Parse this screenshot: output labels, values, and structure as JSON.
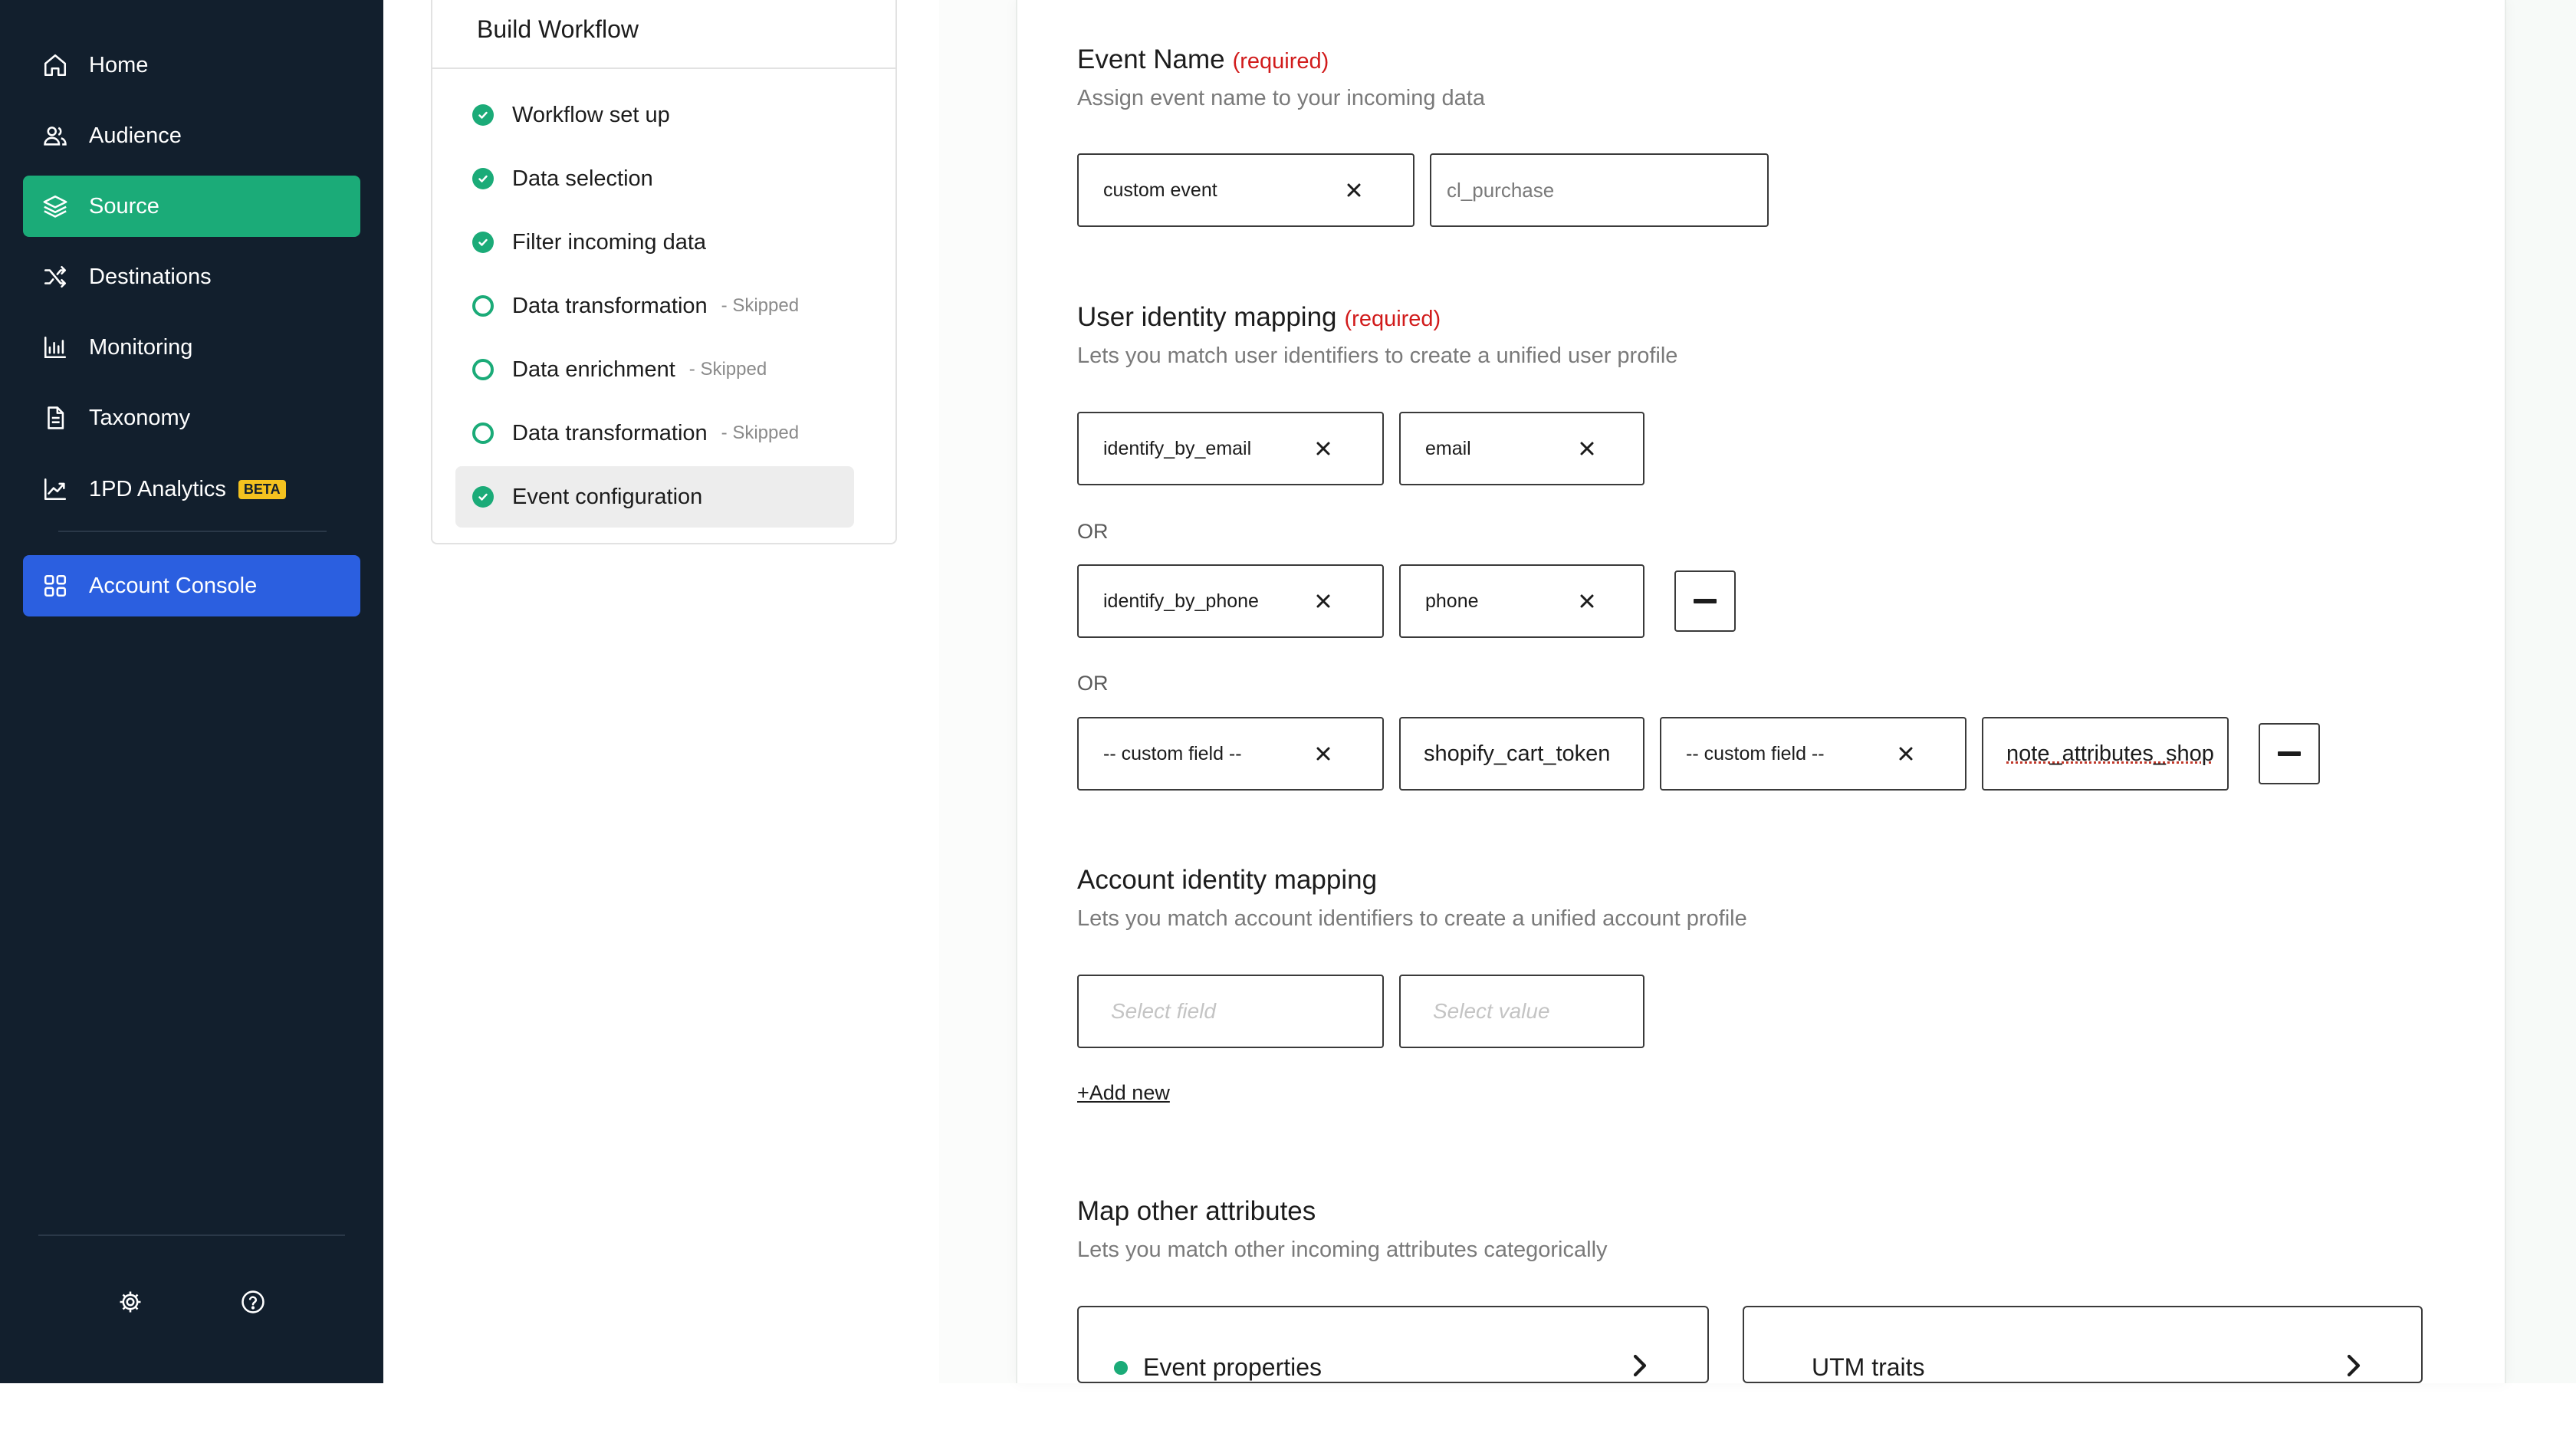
{
  "sidebar": {
    "items": [
      {
        "label": "Home",
        "icon": "home-icon"
      },
      {
        "label": "Audience",
        "icon": "audience-icon"
      },
      {
        "label": "Source",
        "icon": "layers-icon",
        "active": true
      },
      {
        "label": "Destinations",
        "icon": "shuffle-icon"
      },
      {
        "label": "Monitoring",
        "icon": "bar-chart-icon"
      },
      {
        "label": "Taxonomy",
        "icon": "document-icon"
      },
      {
        "label": "1PD Analytics",
        "icon": "line-chart-icon",
        "badge": "BETA"
      }
    ],
    "console": {
      "label": "Account Console",
      "icon": "grid-icon"
    },
    "footer": {
      "settings_icon": "gear-icon",
      "help_icon": "help-icon"
    }
  },
  "workflow": {
    "title": "Build Workflow",
    "steps": [
      {
        "label": "Workflow set up",
        "status": "done"
      },
      {
        "label": "Data selection",
        "status": "done"
      },
      {
        "label": "Filter incoming data",
        "status": "done"
      },
      {
        "label": "Data transformation",
        "status": "todo",
        "note": "- Skipped"
      },
      {
        "label": "Data enrichment",
        "status": "todo",
        "note": "- Skipped"
      },
      {
        "label": "Data transformation",
        "status": "todo",
        "note": "- Skipped"
      },
      {
        "label": "Event configuration",
        "status": "done",
        "current": true
      }
    ]
  },
  "event_name": {
    "title": "Event Name",
    "required": "(required)",
    "subtitle": "Assign event name to your incoming data",
    "type_value": "custom event",
    "name_value": "cl_purchase"
  },
  "user_identity": {
    "title": "User identity mapping",
    "required": "(required)",
    "subtitle": "Lets you match user identifiers to create a unified user profile",
    "or_label": "OR",
    "rows": [
      {
        "field": "identify_by_email",
        "value": "email"
      },
      {
        "field": "identify_by_phone",
        "value": "phone"
      },
      {
        "field": "-- custom field --",
        "value": "shopify_cart_token",
        "field2": "-- custom field --",
        "value2": "note_attributes_shop"
      }
    ]
  },
  "account_identity": {
    "title": "Account identity mapping",
    "subtitle": "Lets you match account identifiers to create a unified account profile",
    "field_placeholder": "Select field",
    "value_placeholder": "Select value",
    "add_new": "+Add new"
  },
  "other_attributes": {
    "title": "Map other attributes",
    "subtitle": "Lets you match other incoming attributes categorically",
    "cards": [
      {
        "label": "Event properties"
      },
      {
        "label": "UTM traits"
      }
    ]
  },
  "colors": {
    "sidebar_bg": "#121f2d",
    "active_green": "#1bab78",
    "console_blue": "#2b5fe0",
    "required_red": "#d11b1b",
    "beta_yellow": "#f4c21f"
  }
}
